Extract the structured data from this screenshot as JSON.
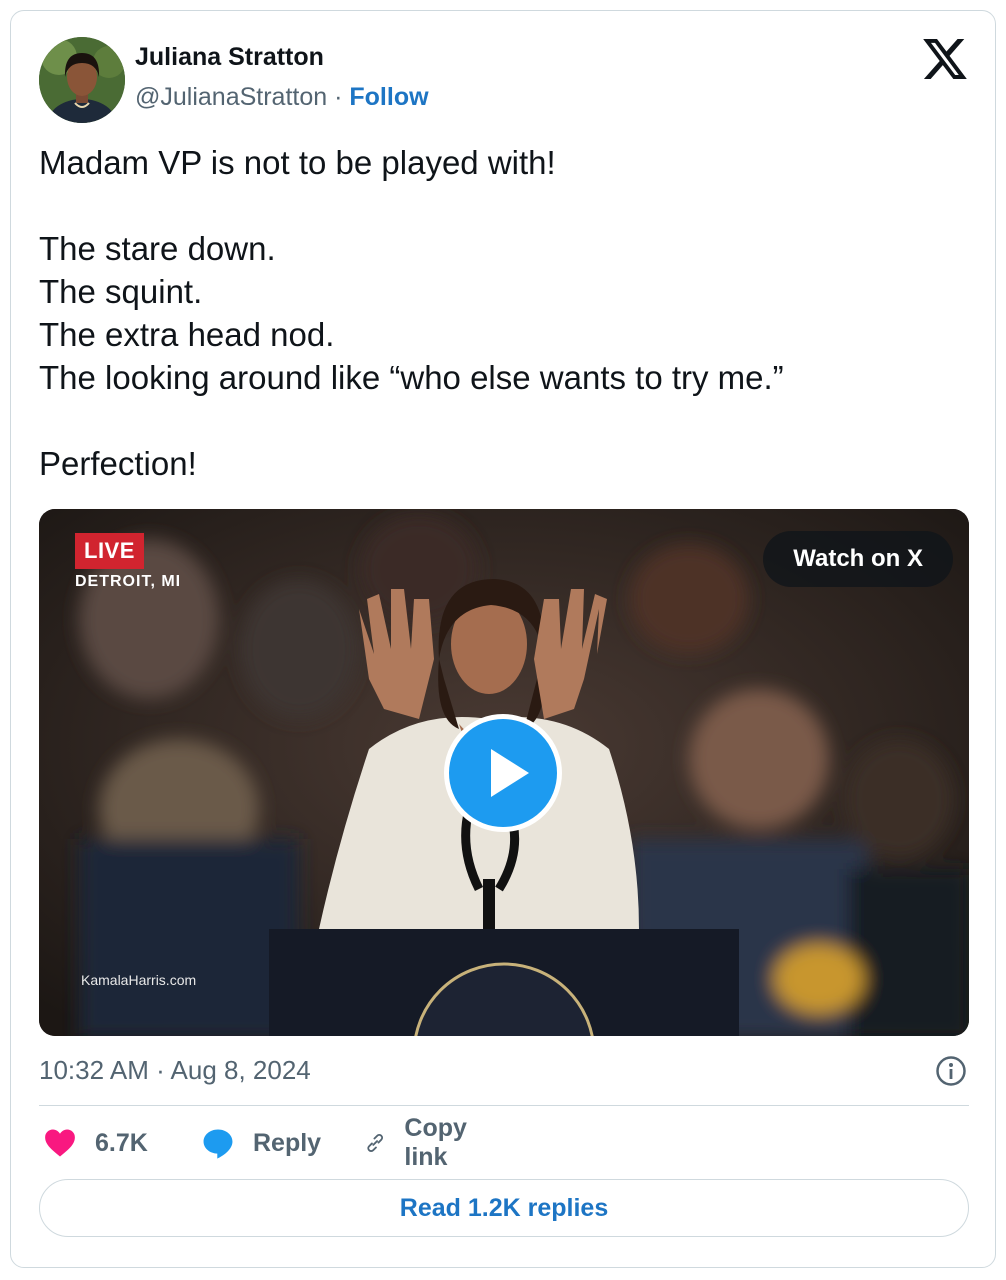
{
  "author": {
    "name": "Juliana Stratton",
    "handle": "@JulianaStratton",
    "separator": "·",
    "follow_label": "Follow"
  },
  "brand_icon": "x-logo-icon",
  "tweet": {
    "lines": [
      "Madam VP is not to be played with!",
      "",
      "The stare down.",
      "The squint.",
      "The extra head nod.",
      "The looking around like “who else wants to try me.”",
      "",
      "Perfection!"
    ]
  },
  "media": {
    "live_badge": "LIVE",
    "location": "DETROIT, MI",
    "watch_label": "Watch on X",
    "watermark": "KamalaHarris.com",
    "play_icon": "play-icon"
  },
  "meta": {
    "timestamp": "10:32 AM · Aug 8, 2024",
    "info_icon": "info-icon"
  },
  "actions": {
    "likes_count": "6.7K",
    "reply_label": "Reply",
    "copy_label": "Copy link"
  },
  "read_replies_label": "Read 1.2K replies",
  "colors": {
    "link_blue": "#1d75c4",
    "play_blue": "#1d9bf0",
    "heart_pink": "#f91880",
    "muted_text": "#536471",
    "border": "#cfd9de",
    "live_red": "#d1242f"
  }
}
